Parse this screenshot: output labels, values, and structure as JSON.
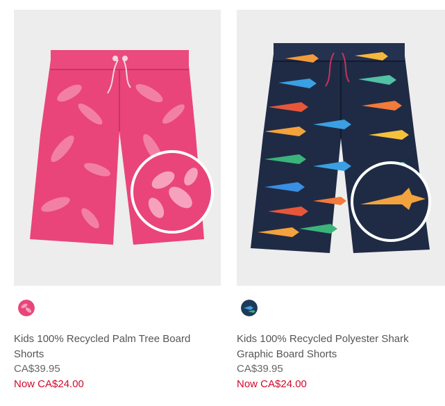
{
  "products": [
    {
      "name": "Kids 100% Recycled Palm Tree Board Shorts",
      "price_original": "CA$39.95",
      "price_sale": "Now CA$24.00",
      "swatch_color": "#e8467a",
      "image_icon": "pink-palm-board-shorts-image"
    },
    {
      "name": "Kids 100% Recycled Polyester Shark Graphic Board Shorts",
      "price_original": "CA$39.95",
      "price_sale": "Now CA$24.00",
      "swatch_color": "#1d3a5a",
      "image_icon": "navy-shark-board-shorts-image"
    }
  ],
  "colors": {
    "sale": "#d00a2c",
    "text": "#555555",
    "image_bg": "#ededed"
  }
}
